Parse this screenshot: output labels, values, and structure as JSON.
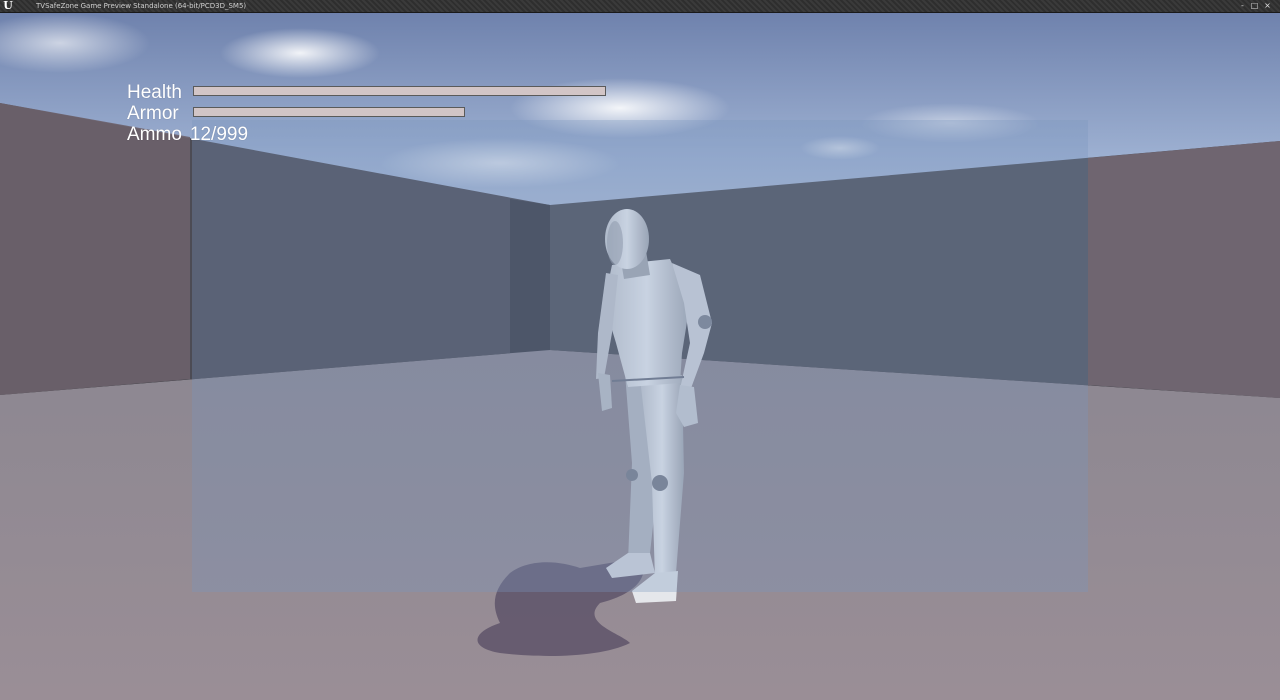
{
  "window": {
    "title": "TVSafeZone Game Preview Standalone (64-bit/PCD3D_SM5)",
    "logo": "U",
    "minimize": "-",
    "maximize": "□",
    "close": "×"
  },
  "hud": {
    "health_label": "Health",
    "armor_label": "Armor",
    "ammo_label": "Ammo",
    "ammo_value": "12/999",
    "health_fraction": 1.0,
    "armor_fraction": 1.0
  },
  "colors": {
    "bar_fill": "#d2c5c6",
    "safe_zone_tint": "#7896be"
  },
  "icons": {
    "logo": "unreal-engine-logo-icon",
    "minimize": "minimize-icon",
    "maximize": "maximize-icon",
    "close": "close-icon"
  }
}
